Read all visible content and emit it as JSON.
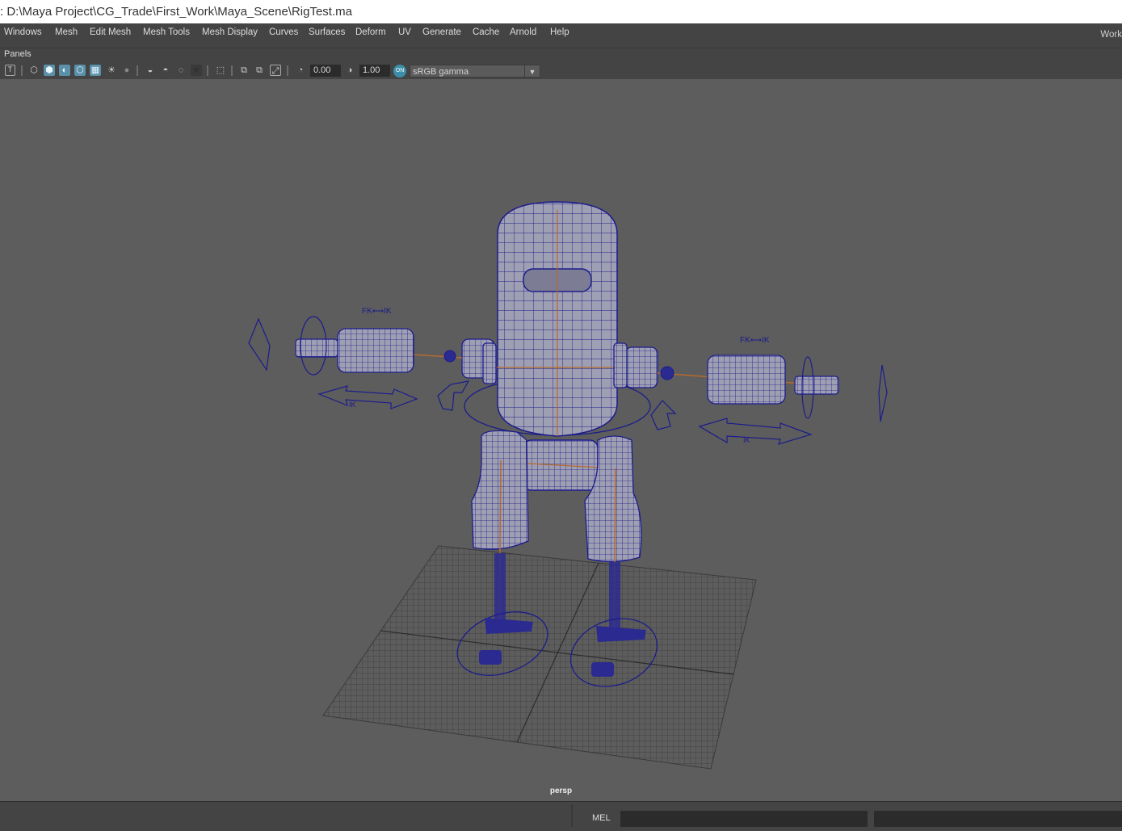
{
  "window": {
    "title": ": D:\\Maya Project\\CG_Trade\\First_Work\\Maya_Scene\\RigTest.ma"
  },
  "menubar": {
    "items": [
      "Windows",
      "Mesh",
      "Edit Mesh",
      "Mesh Tools",
      "Mesh Display",
      "Curves",
      "Surfaces",
      "Deform",
      "UV",
      "Generate",
      "Cache",
      "Arnold",
      "Help"
    ],
    "workspace_label": "Work"
  },
  "panel": {
    "menu_label": "Panels"
  },
  "toolbar": {
    "exposure_value": "0.00",
    "gamma_value": "1.00",
    "color_management_badge": "ON",
    "view_transform": "sRGB gamma"
  },
  "viewport": {
    "camera_label": "persp",
    "annotations": {
      "fk_ik_left": "FK⟷IK",
      "fk_ik_right": "FK⟷IK",
      "ik_label_left": "IK",
      "ik_label_right": "IK"
    },
    "colors": {
      "background": "#5d5d5d",
      "wireframe": "#1c1c8c",
      "mesh_fill": "#9e9eb0",
      "joint": "#d7803c"
    }
  },
  "command_line": {
    "language_label": "MEL"
  }
}
